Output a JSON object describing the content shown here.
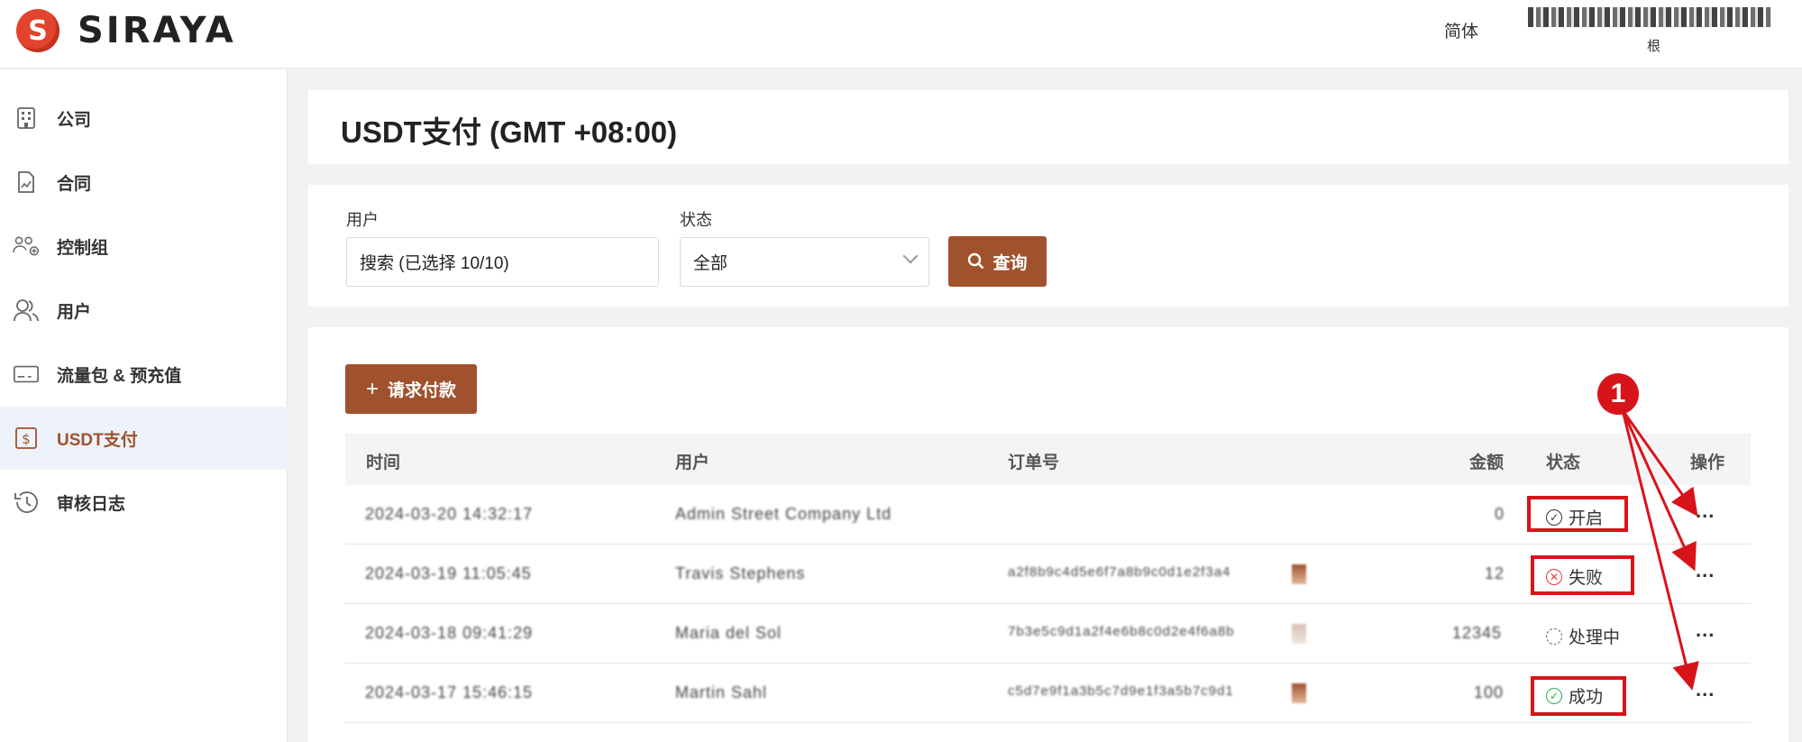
{
  "header": {
    "logo_letter": "S",
    "logo_text": "SIRAYA",
    "language": "简体",
    "user_name": "",
    "user_role": "根"
  },
  "sidebar": {
    "items": [
      {
        "label": "公司",
        "icon": "building-icon"
      },
      {
        "label": "合同",
        "icon": "contract-icon"
      },
      {
        "label": "控制组",
        "icon": "group-settings-icon"
      },
      {
        "label": "用户",
        "icon": "users-icon"
      },
      {
        "label": "流量包 & 预充值",
        "icon": "card-icon"
      },
      {
        "label": "USDT支付",
        "icon": "dollar-icon",
        "active": true
      },
      {
        "label": "审核日志",
        "icon": "history-icon"
      }
    ]
  },
  "page": {
    "title": "USDT支付 (GMT +08:00)"
  },
  "filters": {
    "user_label": "用户",
    "user_value": "搜索 (已选择 10/10)",
    "status_label": "状态",
    "status_value": "全部",
    "query_button": "查询"
  },
  "actions": {
    "request_payment": "请求付款"
  },
  "table": {
    "columns": [
      "时间",
      "用户",
      "订单号",
      "金额",
      "状态",
      "操作"
    ],
    "rows": [
      {
        "time": "2024-03-20 14:32:17",
        "user": "Admin Street Company Ltd",
        "order": "",
        "amount": "0",
        "status": "开启",
        "status_type": "open"
      },
      {
        "time": "2024-03-19 11:05:45",
        "user": "Travis Stephens",
        "order": "a2f8b9c4d5e6f7a8b9c0d1e2f3a4",
        "amount": "12",
        "status": "失败",
        "status_type": "fail"
      },
      {
        "time": "2024-03-18 09:41:29",
        "user": "Maria del Sol",
        "order": "7b3e5c9d1a2f4e6b8c0d2e4f6a8b",
        "amount": "12345",
        "status": "处理中",
        "status_type": "processing"
      },
      {
        "time": "2024-03-17 15:46:15",
        "user": "Martin Sahl",
        "order": "c5d7e9f1a3b5c7d9e1f3a5b7c9d1",
        "amount": "100",
        "status": "成功",
        "status_type": "success"
      }
    ],
    "more_label": "..."
  },
  "annotation": {
    "badge": "1"
  },
  "colors": {
    "accent": "#a0522d",
    "annotation": "#d8141b",
    "success": "#2fae50",
    "fail": "#e0363c"
  }
}
